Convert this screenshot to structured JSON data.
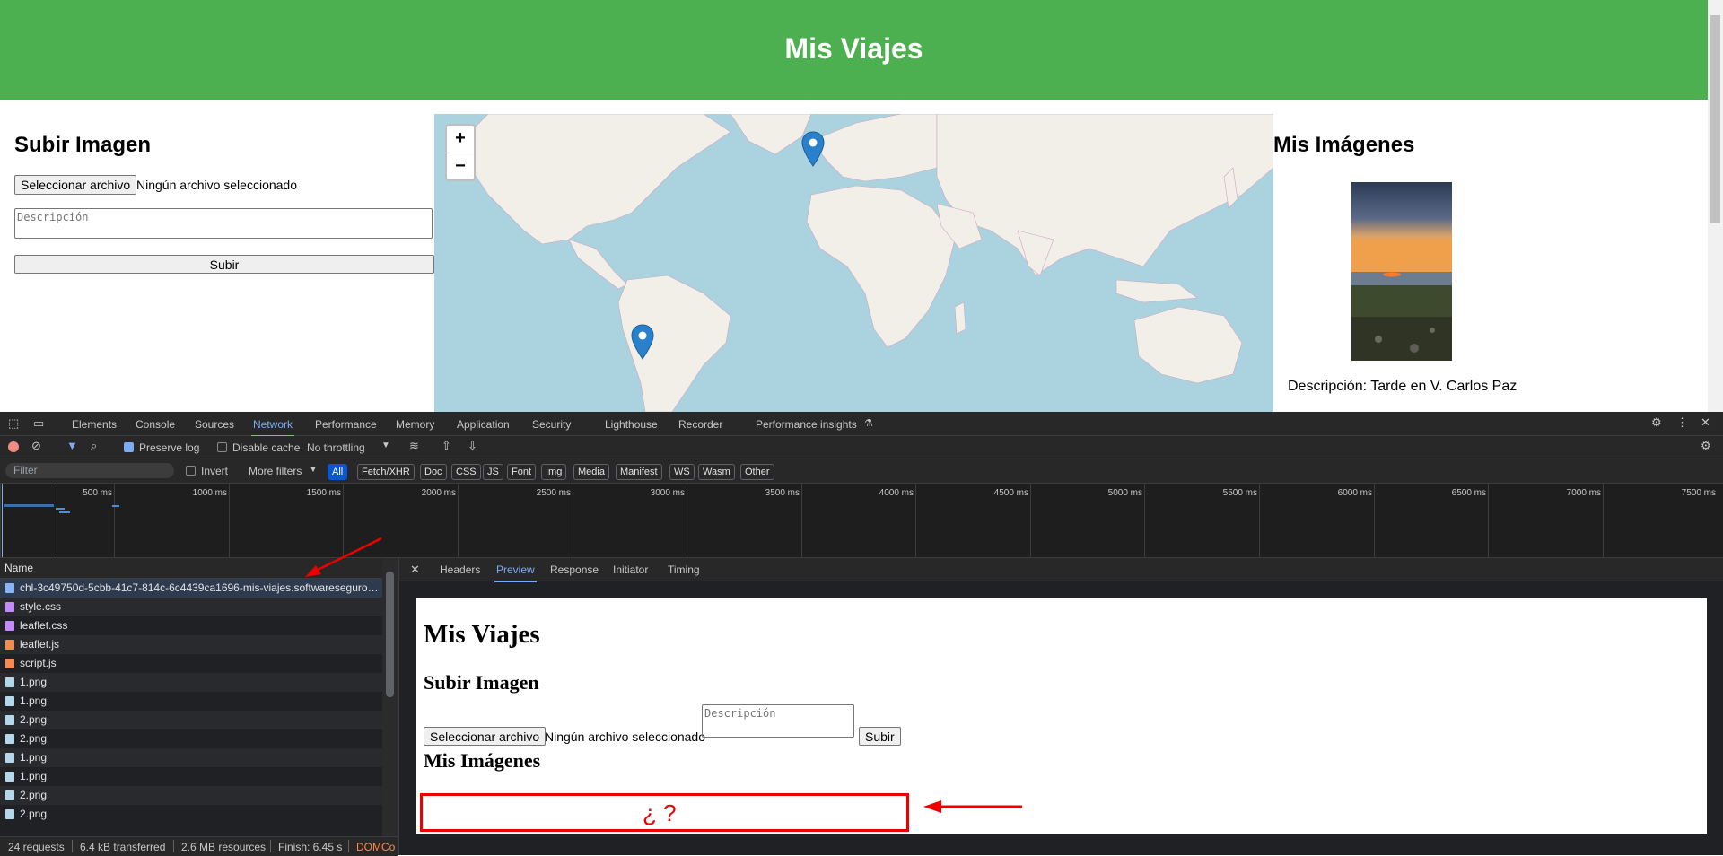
{
  "page": {
    "title": "Mis Viajes",
    "upload": {
      "title": "Subir Imagen",
      "file_button": "Seleccionar archivo",
      "file_status": "Ningún archivo seleccionado",
      "description_placeholder": "Descripción",
      "submit": "Subir"
    },
    "map": {
      "zoom_in": "+",
      "zoom_out": "−"
    },
    "gallery": {
      "title": "Mis Imágenes",
      "caption": "Descripción: Tarde en V. Carlos Paz"
    }
  },
  "devtools": {
    "tabs": [
      "Elements",
      "Console",
      "Sources",
      "Network",
      "Performance",
      "Memory",
      "Application",
      "Security",
      "Lighthouse",
      "Recorder",
      "Performance insights"
    ],
    "active_tab": "Network",
    "toolbar": {
      "preserve_log": "Preserve log",
      "preserve_log_checked": true,
      "disable_cache": "Disable cache",
      "disable_cache_checked": false,
      "throttling": "No throttling"
    },
    "filter": {
      "placeholder": "Filter",
      "invert": "Invert",
      "more_filters": "More filters",
      "types": [
        "All",
        "Fetch/XHR",
        "Doc",
        "CSS",
        "JS",
        "Font",
        "Img",
        "Media",
        "Manifest",
        "WS",
        "Wasm",
        "Other"
      ],
      "active_type": "All"
    },
    "timeline_ticks": [
      "500 ms",
      "1000 ms",
      "1500 ms",
      "2000 ms",
      "2500 ms",
      "3000 ms",
      "3500 ms",
      "4000 ms",
      "4500 ms",
      "5000 ms",
      "5500 ms",
      "6000 ms",
      "6500 ms",
      "7000 ms",
      "7500 ms"
    ],
    "requests": {
      "column_name": "Name",
      "rows": [
        {
          "name": "chl-3c49750d-5cbb-41c7-814c-6c4439ca1696-mis-viajes.softwareseguro.c...",
          "type": "doc",
          "color": "#8ab4f8"
        },
        {
          "name": "style.css",
          "type": "css",
          "color": "#c58af9"
        },
        {
          "name": "leaflet.css",
          "type": "css",
          "color": "#c58af9"
        },
        {
          "name": "leaflet.js",
          "type": "js",
          "color": "#f28b54"
        },
        {
          "name": "script.js",
          "type": "js",
          "color": "#f28b54"
        },
        {
          "name": "1.png",
          "type": "img",
          "color": "#b4d7ea"
        },
        {
          "name": "1.png",
          "type": "img",
          "color": "#b4d7ea"
        },
        {
          "name": "2.png",
          "type": "img",
          "color": "#b4d7ea"
        },
        {
          "name": "2.png",
          "type": "img",
          "color": "#b4d7ea"
        },
        {
          "name": "1.png",
          "type": "img",
          "color": "#b4d7ea"
        },
        {
          "name": "1.png",
          "type": "img",
          "color": "#b4d7ea"
        },
        {
          "name": "2.png",
          "type": "img",
          "color": "#b4d7ea"
        },
        {
          "name": "2.png",
          "type": "img",
          "color": "#b4d7ea"
        }
      ]
    },
    "detail_tabs": [
      "Headers",
      "Preview",
      "Response",
      "Initiator",
      "Timing"
    ],
    "active_detail_tab": "Preview",
    "preview": {
      "h1": "Mis Viajes",
      "upload_title": "Subir Imagen",
      "file_button": "Seleccionar archivo",
      "file_status": "Ningún archivo seleccionado",
      "description_placeholder": "Descripción",
      "submit": "Subir",
      "gallery_title": "Mis Imágenes",
      "annotation": "¿ ?"
    },
    "status": {
      "requests": "24 requests",
      "transferred": "6.4 kB transferred",
      "resources": "2.6 MB resources",
      "finish": "Finish: 6.45 s",
      "domcontent": "DOMCo"
    }
  },
  "colors": {
    "banner": "#4caf50",
    "accent": "#7cacf8",
    "annotation": "#ee0000",
    "map_water": "#aad3df",
    "marker": "#2a81cb"
  }
}
